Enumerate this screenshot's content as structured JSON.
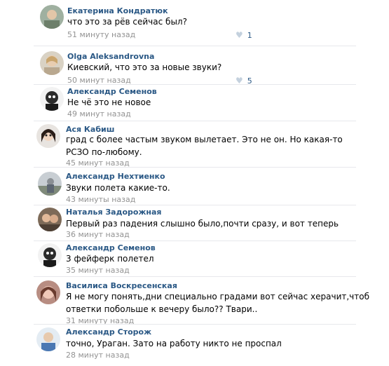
{
  "comments": [
    {
      "author": "Екатерина Кондратюк",
      "lines": [
        "что это за рёв сейчас был?"
      ],
      "time": "51 минуту назад",
      "likes": "1"
    },
    {
      "author": "Olga Aleksandrovna",
      "lines": [
        "Киевский, что это за новые звуки?"
      ],
      "time": "50 минут назад",
      "likes": "5"
    },
    {
      "author": "Александр Семенов",
      "lines": [
        "Не чё это не новое"
      ],
      "time": "49 минут назад",
      "likes": ""
    },
    {
      "author": "Ася Кабиш",
      "lines": [
        "град с более частым звуком вылетает. Это не он. Но какая-то",
        "РСЗО по-любому."
      ],
      "time": "45 минут назад",
      "likes": ""
    },
    {
      "author": "Александр Нехтиенко",
      "lines": [
        "Звуки полета какие-то."
      ],
      "time": "43 минуты назад",
      "likes": ""
    },
    {
      "author": "Наталья Задорожная",
      "lines": [
        "Первый раз падения слышно было,почти сразу, и вот теперь"
      ],
      "time": "36 минут назад",
      "likes": ""
    },
    {
      "author": "Александр Семенов",
      "lines": [
        "3 фейферк полетел"
      ],
      "time": "35 минут назад",
      "likes": ""
    },
    {
      "author": "Василиса Воскресенская",
      "lines": [
        "Я не могу понять,дни специально градами вот сейчас херачит,чтоб",
        "ответки побольше к вечеру было?? Твари.."
      ],
      "time": "31 минуту назад",
      "likes": ""
    },
    {
      "author": "Александр Сторож",
      "lines": [
        "точно, Ураган. Зато на работу никто не проспал"
      ],
      "time": "28 минут назад",
      "likes": ""
    }
  ]
}
